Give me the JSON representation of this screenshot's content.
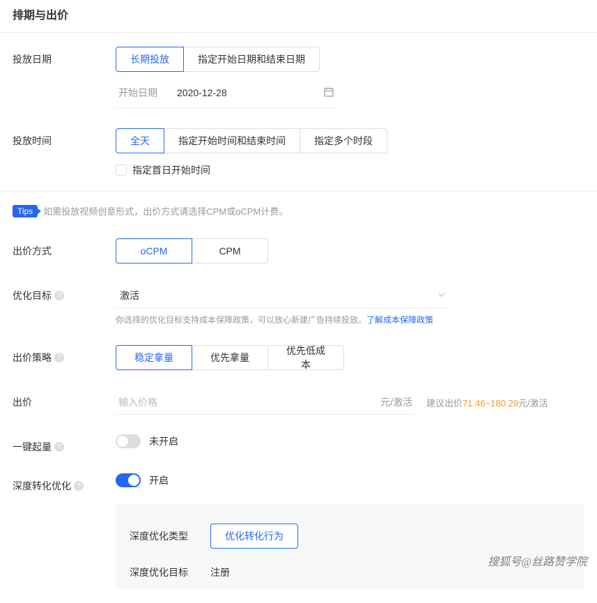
{
  "header": {
    "title": "排期与出价"
  },
  "schedule": {
    "date_label": "投放日期",
    "date_option_longterm": "长期投放",
    "date_option_range": "指定开始日期和结束日期",
    "start_date_label": "开始日期",
    "start_date_value": "2020-12-28",
    "time_label": "投放时间",
    "time_option_allday": "全天",
    "time_option_range": "指定开始时间和结束时间",
    "time_option_multi": "指定多个时段",
    "firstday_checkbox": "指定首日开始时间"
  },
  "tips": {
    "badge": "Tips",
    "text": "如需投放视频创意形式，出价方式请选择CPM或oCPM计费。"
  },
  "bidding": {
    "method_label": "出价方式",
    "method_ocpm": "oCPM",
    "method_cpm": "CPM",
    "goal_label": "优化目标",
    "goal_value": "激活",
    "goal_help": "你选择的优化目标支持成本保障政策，可以放心新建广告持续投放。",
    "goal_help_link": "了解成本保障政策",
    "strategy_label": "出价策略",
    "strategy_stable": "稳定拿量",
    "strategy_priority": "优先拿量",
    "strategy_lowcost": "优先低成本",
    "price_label": "出价",
    "price_placeholder": "输入价格",
    "price_unit": "元/激活",
    "suggest_prefix": "建议出价",
    "suggest_range": "71.46~180.29",
    "suggest_suffix": "元/激活",
    "boost_label": "一键起量",
    "boost_status": "未开启",
    "deep_label": "深度转化优化",
    "deep_status": "开启",
    "deep_sub": {
      "type_label": "深度优化类型",
      "type_value": "优化转化行为",
      "goal_label": "深度优化目标",
      "goal_value": "注册"
    }
  },
  "watermark": "搜狐号@丝路赞学院"
}
